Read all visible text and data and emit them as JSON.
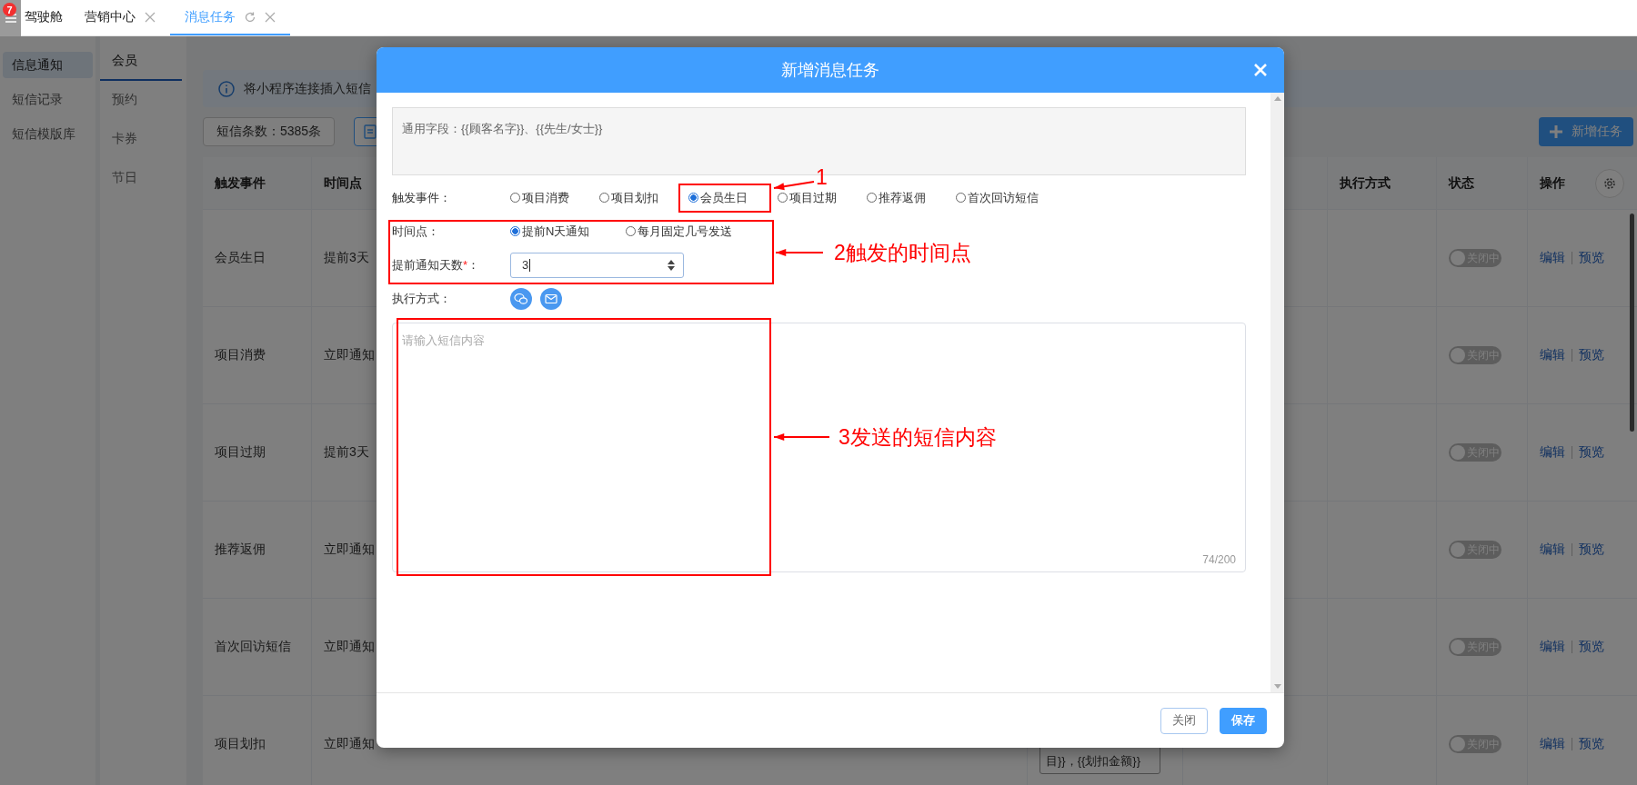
{
  "tabs_bar": {
    "badge": "7",
    "tabs": [
      {
        "label": "驾驶舱",
        "selected": false,
        "closable": false,
        "refreshable": false
      },
      {
        "label": "营销中心",
        "selected": false,
        "closable": true,
        "refreshable": false
      },
      {
        "label": "消息任务",
        "selected": true,
        "closable": true,
        "refreshable": true
      }
    ]
  },
  "sidebar": {
    "items": [
      {
        "label": "信息通知",
        "selected": true
      },
      {
        "label": "短信记录",
        "selected": false
      },
      {
        "label": "短信模版库",
        "selected": false
      }
    ]
  },
  "subnav": {
    "items": [
      {
        "label": "会员",
        "selected": true
      },
      {
        "label": "预约",
        "selected": false
      },
      {
        "label": "卡券",
        "selected": false
      },
      {
        "label": "节日",
        "selected": false
      }
    ]
  },
  "notice": {
    "text": "将小程序连接插入短信"
  },
  "toolbar": {
    "sms_count": "短信条数：5385条",
    "add_button": "新增任务"
  },
  "table": {
    "columns": [
      {
        "label": "触发事件"
      },
      {
        "label": "时间点"
      },
      {
        "label": "执行方式"
      },
      {
        "label": "状态"
      },
      {
        "label": "操作"
      }
    ],
    "rows": [
      {
        "event": "会员生日",
        "time": "提前3天",
        "on": false,
        "status": "关闭中",
        "actions": [
          "编辑",
          "预览"
        ]
      },
      {
        "event": "项目消费",
        "time": "立即通知",
        "on": false,
        "status": "关闭中",
        "actions": [
          "编辑",
          "预览"
        ]
      },
      {
        "event": "项目过期",
        "time": "提前3天",
        "on": false,
        "status": "关闭中",
        "actions": [
          "编辑",
          "预览"
        ]
      },
      {
        "event": "推荐返佣",
        "time": "立即通知",
        "on": false,
        "status": "关闭中",
        "actions": [
          "编辑",
          "预览"
        ]
      },
      {
        "event": "首次回访短信",
        "time": "立即通知",
        "on": false,
        "status": "关闭中",
        "actions": [
          "编辑",
          "预览"
        ]
      },
      {
        "event": "项目划扣",
        "time": "立即通知",
        "on": false,
        "status": "关闭中",
        "actions": [
          "编辑",
          "预览"
        ],
        "content": "目}}，{{划扣金额}}"
      }
    ]
  },
  "dialog": {
    "title": "新增消息任务",
    "fields_hint": "通用字段：{{顾客名字}}、{{先生/女士}}",
    "trigger": {
      "label": "触发事件：",
      "options": [
        {
          "label": "项目消费",
          "selected": false
        },
        {
          "label": "项目划扣",
          "selected": false
        },
        {
          "label": "会员生日",
          "selected": true
        },
        {
          "label": "项目过期",
          "selected": false
        },
        {
          "label": "推荐返佣",
          "selected": false
        },
        {
          "label": "首次回访短信",
          "selected": false
        }
      ]
    },
    "timing": {
      "label": "时间点：",
      "options": [
        {
          "label": "提前N天通知",
          "selected": true
        },
        {
          "label": "每月固定几号发送",
          "selected": false
        }
      ]
    },
    "days": {
      "label": "提前通知天数",
      "required_mark": "*",
      "suffix": "：",
      "value": "3"
    },
    "methods": {
      "label": "执行方式："
    },
    "message": {
      "placeholder": "请输入短信内容",
      "counter": "74/200"
    },
    "buttons": [
      {
        "label": "关闭",
        "kind": "secondary"
      },
      {
        "label": "保存",
        "kind": "primary"
      }
    ]
  },
  "annotations": [
    {
      "text": "1"
    },
    {
      "text": "2触发的时间点"
    },
    {
      "text": "3发送的短信内容"
    }
  ]
}
